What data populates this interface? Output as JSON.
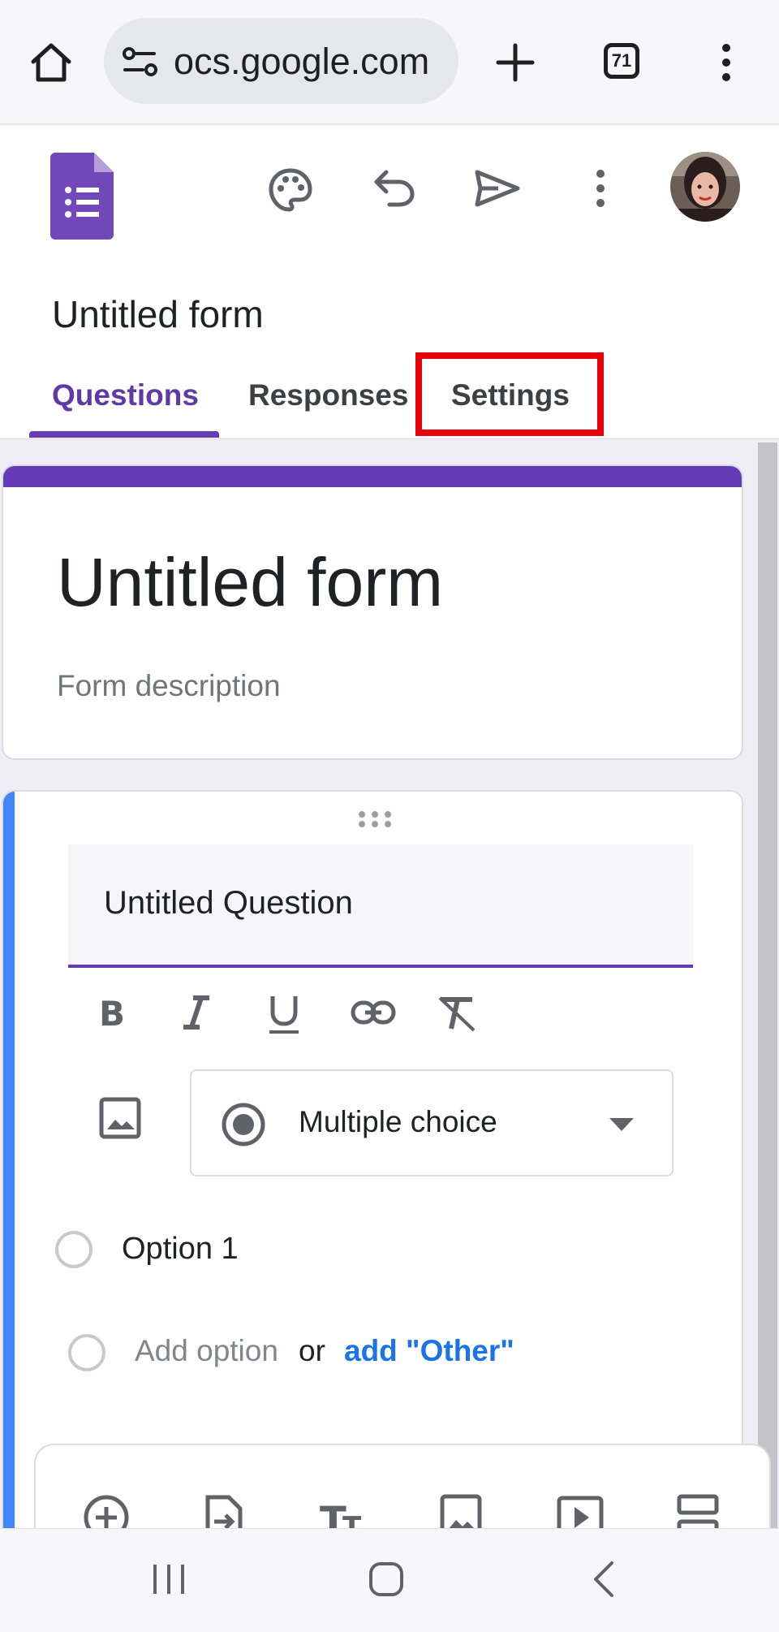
{
  "browser": {
    "url": "ocs.google.com",
    "tab_count": "71",
    "icons": [
      "home-icon",
      "site-settings-icon",
      "new-tab-icon",
      "tab-switcher-icon",
      "overflow-menu-icon"
    ]
  },
  "app_header": {
    "title": "Untitled form",
    "icons": [
      "forms-logo-icon",
      "palette-icon",
      "undo-icon",
      "send-icon",
      "more-vert-icon",
      "avatar"
    ],
    "tabs": [
      {
        "label": "Questions",
        "active": true
      },
      {
        "label": "Responses",
        "active": false
      },
      {
        "label": "Settings",
        "active": false,
        "highlighted": true
      }
    ]
  },
  "form_header": {
    "title": "Untitled form",
    "description_placeholder": "Form description"
  },
  "question": {
    "title": "Untitled Question",
    "type": "Multiple choice",
    "options": [
      "Option 1"
    ],
    "add_option": "Add option",
    "or_text": "or",
    "add_other": "add \"Other\""
  },
  "colors": {
    "accent": "#673ab7",
    "question_bar": "#4285f4",
    "highlight_box": "#e8000b",
    "link": "#1a73e8"
  }
}
